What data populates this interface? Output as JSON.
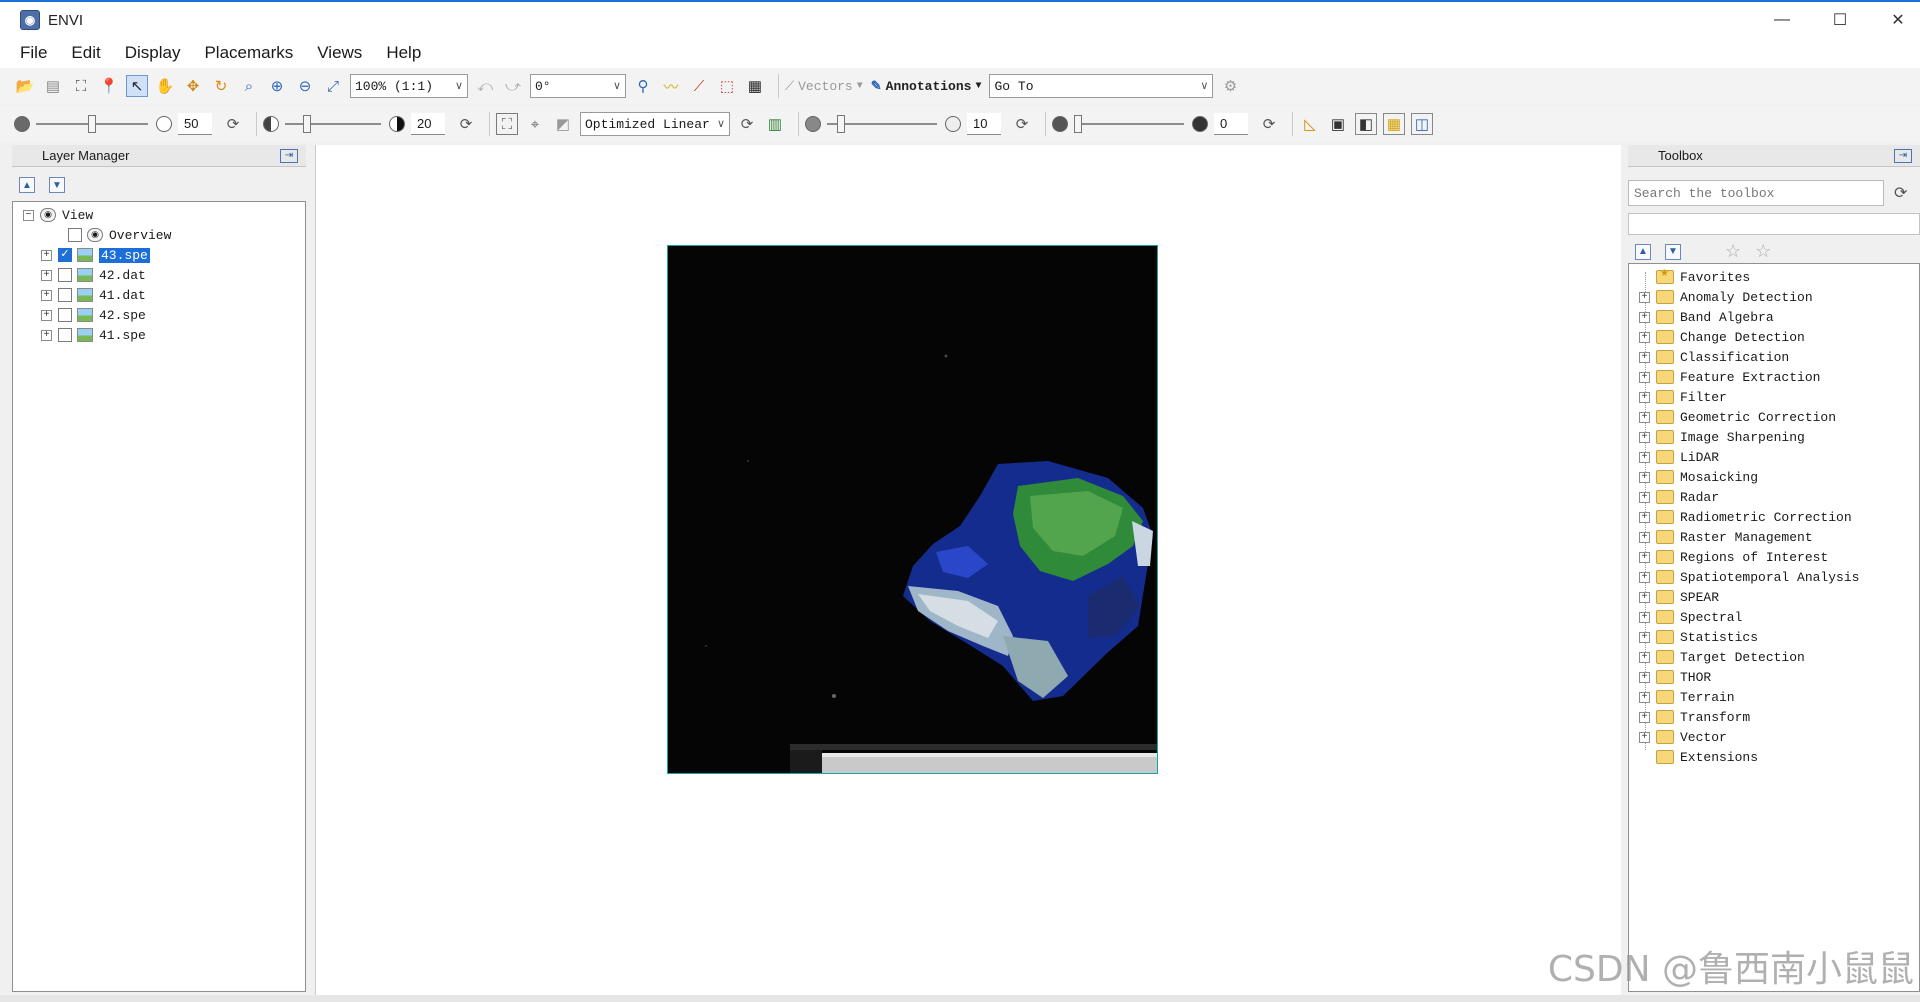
{
  "window": {
    "title": "ENVI",
    "minimize": "—",
    "maximize": "☐",
    "close": "✕"
  },
  "menu": [
    "File",
    "Edit",
    "Display",
    "Placemarks",
    "Views",
    "Help"
  ],
  "toolbar1": {
    "zoom_value": "100% (1:1)",
    "rotation_value": "0°",
    "vectors_label": "Vectors",
    "annotations_label": "Annotations",
    "goto_value": "Go To"
  },
  "toolbar2": {
    "brightness_value": "50",
    "contrast_value": "20",
    "stretch_value": "Optimized Linear",
    "sharpen_value": "10",
    "transparency_value": "0",
    "brightness_level": 0.5,
    "contrast_level": 0.2,
    "sharpen_level": 0.1,
    "transparency_level": 0.0
  },
  "layer_manager": {
    "title": "Layer Manager",
    "root": "View",
    "overview": "Overview",
    "layers": [
      {
        "name": "43.spe",
        "checked": true,
        "selected": true
      },
      {
        "name": "42.dat",
        "checked": false,
        "selected": false
      },
      {
        "name": "41.dat",
        "checked": false,
        "selected": false
      },
      {
        "name": "42.spe",
        "checked": false,
        "selected": false
      },
      {
        "name": "41.spe",
        "checked": false,
        "selected": false
      }
    ]
  },
  "toolbox": {
    "title": "Toolbox",
    "search_placeholder": "Search the toolbox",
    "items": [
      "Favorites",
      "Anomaly Detection",
      "Band Algebra",
      "Change Detection",
      "Classification",
      "Feature Extraction",
      "Filter",
      "Geometric Correction",
      "Image Sharpening",
      "LiDAR",
      "Mosaicking",
      "Radar",
      "Radiometric Correction",
      "Raster Management",
      "Regions of Interest",
      "Spatiotemporal Analysis",
      "SPEAR",
      "Spectral",
      "Statistics",
      "Target Detection",
      "THOR",
      "Terrain",
      "Transform",
      "Vector",
      "Extensions"
    ]
  },
  "watermark": "CSDN @鲁西南小鼠鼠"
}
